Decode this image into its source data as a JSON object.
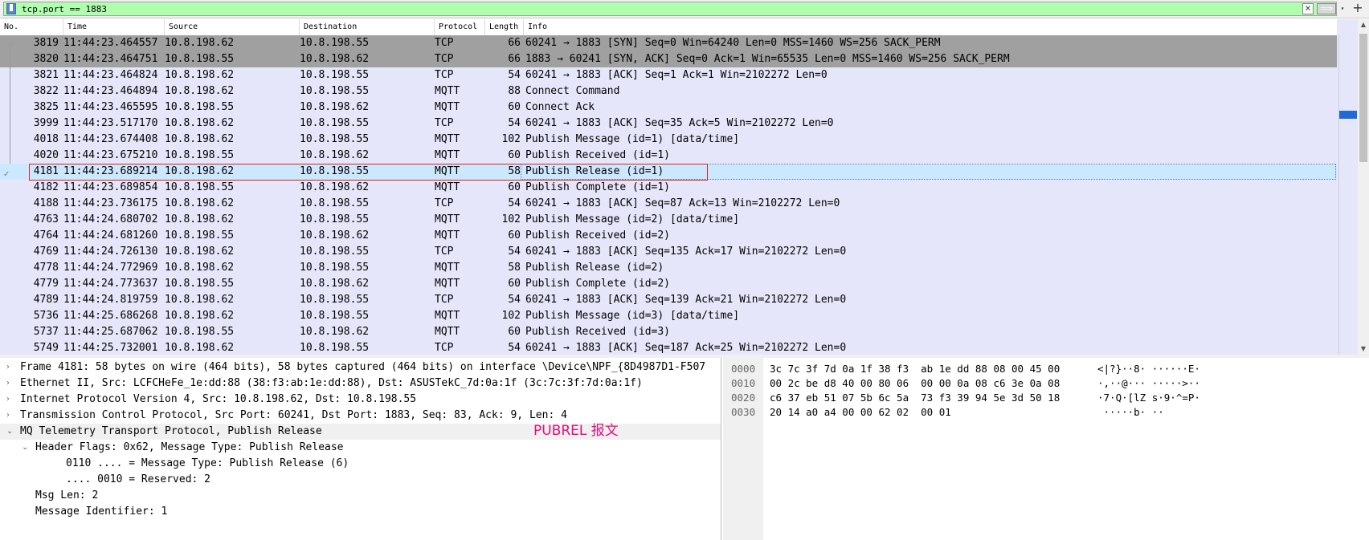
{
  "filter": {
    "value": "tcp.port == 1883",
    "clear_icon": "×",
    "apply_icon": "⟹",
    "dropdown_icon": "▾",
    "add_icon": "+"
  },
  "columns": [
    "No.",
    "Time",
    "Source",
    "Destination",
    "Protocol",
    "Length",
    "Info"
  ],
  "packets": [
    {
      "no": "3819",
      "time": "11:44:23.464557",
      "src": "10.8.198.62",
      "dst": "10.8.198.55",
      "proto": "TCP",
      "len": "66",
      "info": "60241 → 1883 [SYN] Seq=0 Win=64240 Len=0 MSS=1460 WS=256 SACK_PERM"
    },
    {
      "no": "3820",
      "time": "11:44:23.464751",
      "src": "10.8.198.55",
      "dst": "10.8.198.62",
      "proto": "TCP",
      "len": "66",
      "info": "1883 → 60241 [SYN, ACK] Seq=0 Ack=1 Win=65535 Len=0 MSS=1460 WS=256 SACK_PERM"
    },
    {
      "no": "3821",
      "time": "11:44:23.464824",
      "src": "10.8.198.62",
      "dst": "10.8.198.55",
      "proto": "TCP",
      "len": "54",
      "info": "60241 → 1883 [ACK] Seq=1 Ack=1 Win=2102272 Len=0"
    },
    {
      "no": "3822",
      "time": "11:44:23.464894",
      "src": "10.8.198.62",
      "dst": "10.8.198.55",
      "proto": "MQTT",
      "len": "88",
      "info": "Connect Command"
    },
    {
      "no": "3825",
      "time": "11:44:23.465595",
      "src": "10.8.198.55",
      "dst": "10.8.198.62",
      "proto": "MQTT",
      "len": "60",
      "info": "Connect Ack"
    },
    {
      "no": "3999",
      "time": "11:44:23.517170",
      "src": "10.8.198.62",
      "dst": "10.8.198.55",
      "proto": "TCP",
      "len": "54",
      "info": "60241 → 1883 [ACK] Seq=35 Ack=5 Win=2102272 Len=0"
    },
    {
      "no": "4018",
      "time": "11:44:23.674408",
      "src": "10.8.198.62",
      "dst": "10.8.198.55",
      "proto": "MQTT",
      "len": "102",
      "info": "Publish Message (id=1) [data/time]"
    },
    {
      "no": "4020",
      "time": "11:44:23.675210",
      "src": "10.8.198.55",
      "dst": "10.8.198.62",
      "proto": "MQTT",
      "len": "60",
      "info": "Publish Received (id=1)"
    },
    {
      "no": "4181",
      "time": "11:44:23.689214",
      "src": "10.8.198.62",
      "dst": "10.8.198.55",
      "proto": "MQTT",
      "len": "58",
      "info": "Publish Release (id=1)"
    },
    {
      "no": "4182",
      "time": "11:44:23.689854",
      "src": "10.8.198.55",
      "dst": "10.8.198.62",
      "proto": "MQTT",
      "len": "60",
      "info": "Publish Complete (id=1)"
    },
    {
      "no": "4188",
      "time": "11:44:23.736175",
      "src": "10.8.198.62",
      "dst": "10.8.198.55",
      "proto": "TCP",
      "len": "54",
      "info": "60241 → 1883 [ACK] Seq=87 Ack=13 Win=2102272 Len=0"
    },
    {
      "no": "4763",
      "time": "11:44:24.680702",
      "src": "10.8.198.62",
      "dst": "10.8.198.55",
      "proto": "MQTT",
      "len": "102",
      "info": "Publish Message (id=2) [data/time]"
    },
    {
      "no": "4764",
      "time": "11:44:24.681260",
      "src": "10.8.198.55",
      "dst": "10.8.198.62",
      "proto": "MQTT",
      "len": "60",
      "info": "Publish Received (id=2)"
    },
    {
      "no": "4769",
      "time": "11:44:24.726130",
      "src": "10.8.198.62",
      "dst": "10.8.198.55",
      "proto": "TCP",
      "len": "54",
      "info": "60241 → 1883 [ACK] Seq=135 Ack=17 Win=2102272 Len=0"
    },
    {
      "no": "4778",
      "time": "11:44:24.772969",
      "src": "10.8.198.62",
      "dst": "10.8.198.55",
      "proto": "MQTT",
      "len": "58",
      "info": "Publish Release (id=2)"
    },
    {
      "no": "4779",
      "time": "11:44:24.773637",
      "src": "10.8.198.55",
      "dst": "10.8.198.62",
      "proto": "MQTT",
      "len": "60",
      "info": "Publish Complete (id=2)"
    },
    {
      "no": "4789",
      "time": "11:44:24.819759",
      "src": "10.8.198.62",
      "dst": "10.8.198.55",
      "proto": "TCP",
      "len": "54",
      "info": "60241 → 1883 [ACK] Seq=139 Ack=21 Win=2102272 Len=0"
    },
    {
      "no": "5736",
      "time": "11:44:25.686268",
      "src": "10.8.198.62",
      "dst": "10.8.198.55",
      "proto": "MQTT",
      "len": "102",
      "info": "Publish Message (id=3) [data/time]"
    },
    {
      "no": "5737",
      "time": "11:44:25.687062",
      "src": "10.8.198.55",
      "dst": "10.8.198.62",
      "proto": "MQTT",
      "len": "60",
      "info": "Publish Received (id=3)"
    },
    {
      "no": "5749",
      "time": "11:44:25.732001",
      "src": "10.8.198.62",
      "dst": "10.8.198.55",
      "proto": "TCP",
      "len": "54",
      "info": "60241 → 1883 [ACK] Seq=187 Ack=25 Win=2102272 Len=0"
    }
  ],
  "selected_packet": "4181",
  "details": [
    {
      "arrow": "›",
      "indent": 0,
      "text": "Frame 4181: 58 bytes on wire (464 bits), 58 bytes captured (464 bits) on interface \\Device\\NPF_{8D4987D1-F507"
    },
    {
      "arrow": "›",
      "indent": 0,
      "text": "Ethernet II, Src: LCFCHeFe_1e:dd:88 (38:f3:ab:1e:dd:88), Dst: ASUSTekC_7d:0a:1f (3c:7c:3f:7d:0a:1f)"
    },
    {
      "arrow": "›",
      "indent": 0,
      "text": "Internet Protocol Version 4, Src: 10.8.198.62, Dst: 10.8.198.55"
    },
    {
      "arrow": "›",
      "indent": 0,
      "text": "Transmission Control Protocol, Src Port: 60241, Dst Port: 1883, Seq: 83, Ack: 9, Len: 4"
    },
    {
      "arrow": "⌄",
      "indent": 0,
      "text": "MQ Telemetry Transport Protocol, Publish Release"
    },
    {
      "arrow": "⌄",
      "indent": 1,
      "text": "Header Flags: 0x62, Message Type: Publish Release"
    },
    {
      "arrow": "",
      "indent": 3,
      "text": "0110 .... = Message Type: Publish Release (6)"
    },
    {
      "arrow": "",
      "indent": 3,
      "text": ".... 0010 = Reserved: 2"
    },
    {
      "arrow": "",
      "indent": 1,
      "text": "Msg Len: 2"
    },
    {
      "arrow": "",
      "indent": 1,
      "text": "Message Identifier: 1"
    }
  ],
  "annotation": "PUBREL 报文",
  "bytes": [
    {
      "offset": "0000",
      "hex": "3c 7c 3f 7d 0a 1f 38 f3  ab 1e dd 88 08 00 45 00",
      "ascii": "<|?}··8· ······E·"
    },
    {
      "offset": "0010",
      "hex": "00 2c be d8 40 00 80 06  00 00 0a 08 c6 3e 0a 08",
      "ascii": "·,··@··· ·····>··"
    },
    {
      "offset": "0020",
      "hex": "c6 37 eb 51 07 5b 6c 5a  73 f3 39 94 5e 3d 50 18",
      "ascii": "·7·Q·[lZ s·9·^=P·"
    },
    {
      "offset": "0030",
      "hex": "20 14 a0 a4 00 00 62 02  00 01",
      "ascii": " ·····b· ··"
    }
  ],
  "colors": {
    "filter_ok": "#afffaf",
    "row_default": "#e6e6fa",
    "row_handshake": "#a0a0a0",
    "row_selected": "#cce8ff",
    "highlight": "#e02020",
    "annotation": "#e0107a"
  }
}
